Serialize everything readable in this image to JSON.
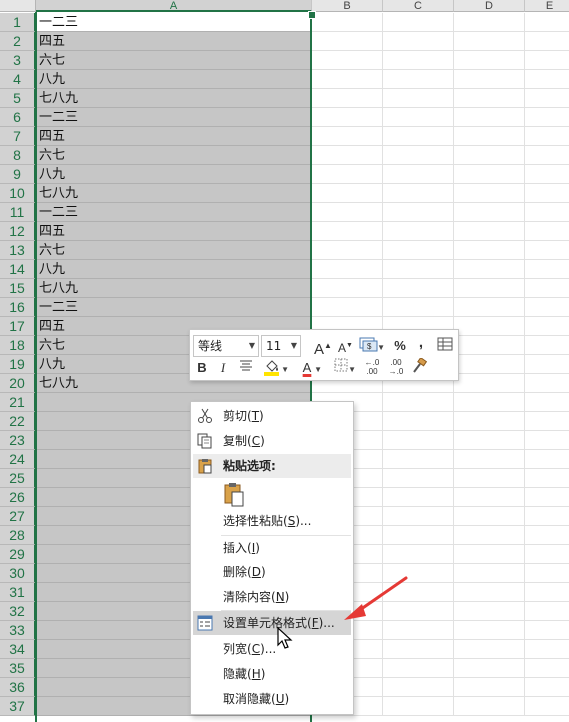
{
  "columns": [
    "A",
    "B",
    "C",
    "D",
    "E"
  ],
  "cells": [
    "一二三",
    "四五",
    "六七",
    "八九",
    "七八九",
    "一二三",
    "四五",
    "六七",
    "八九",
    "七八九",
    "一二三",
    "四五",
    "六七",
    "八九",
    "七八九",
    "一二三",
    "四五",
    "六七",
    "八九",
    "七八九"
  ],
  "row_numbers": [
    "1",
    "2",
    "3",
    "4",
    "5",
    "6",
    "7",
    "8",
    "9",
    "10",
    "11",
    "12",
    "13",
    "14",
    "15",
    "16",
    "17",
    "18",
    "19",
    "20",
    "21",
    "22",
    "23",
    "24",
    "25",
    "26",
    "27",
    "28",
    "29",
    "30",
    "31",
    "32",
    "33",
    "34",
    "35",
    "36",
    "37"
  ],
  "colors": {
    "accent": "#217346",
    "selection_fill": "#c6c6c6",
    "arrow": "#e53935",
    "font_red": "#e53935",
    "fill_yellow": "#ffe400"
  },
  "mini_toolbar": {
    "font_name": "等线",
    "font_size": "11",
    "grow_font": "A",
    "shrink_font": "A",
    "percent": "%",
    "comma": ",",
    "bold": "B",
    "italic": "I",
    "font_color_letter": "A",
    "increase_decimal": ".00",
    "decrease_decimal": ".0"
  },
  "menu": {
    "cut": {
      "label": "剪切(",
      "key": "T",
      "end": ")"
    },
    "copy": {
      "label": "复制(",
      "key": "C",
      "end": ")"
    },
    "paste_options": "粘贴选项:",
    "paste_special": {
      "label": "选择性粘贴(",
      "key": "S",
      "end": ")..."
    },
    "insert": {
      "label": "插入(",
      "key": "I",
      "end": ")"
    },
    "delete": {
      "label": "删除(",
      "key": "D",
      "end": ")"
    },
    "clear": {
      "label": "清除内容(",
      "key": "N",
      "end": ")"
    },
    "format_cells": {
      "label": "设置单元格格式(",
      "key": "F",
      "end": ")..."
    },
    "col_width": {
      "label": "列宽(",
      "key": "C",
      "end": ")..."
    },
    "hide": {
      "label": "隐藏(",
      "key": "H",
      "end": ")"
    },
    "unhide": {
      "label": "取消隐藏(",
      "key": "U",
      "end": ")"
    }
  }
}
